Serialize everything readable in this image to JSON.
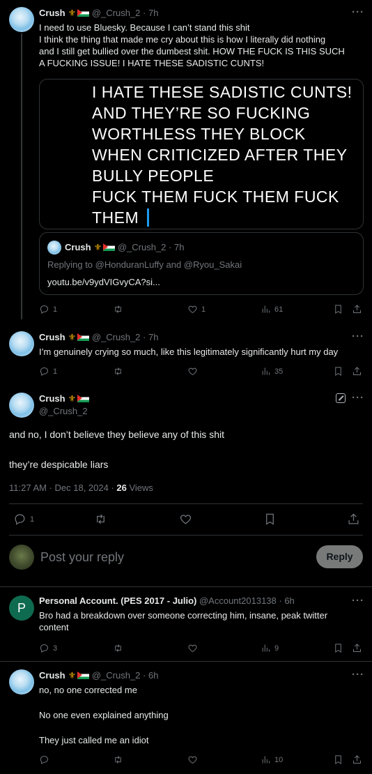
{
  "tweet1": {
    "name": "Crush",
    "handle": "@_Crush_2",
    "time": "7h",
    "text_lines": [
      "I need to use Bluesky. Because I can’t stand this shit",
      "I think the thing that made me cry about this is how I literally did nothing",
      "and I still get bullied over the dumbest shit. HOW THE FUCK IS THIS SUCH",
      "A FUCKING ISSUE!  I HATE THESE SADISTIC CUNTS!"
    ],
    "image_text_lines": [
      "I HATE THESE SADISTIC CUNTS!",
      "AND THEY’RE SO FUCKING",
      "WORTHLESS THEY BLOCK",
      "WHEN CRITICIZED AFTER THEY",
      "BULLY PEOPLE",
      "FUCK THEM FUCK THEM FUCK",
      "THEM"
    ],
    "quote": {
      "name": "Crush",
      "handle": "@_Crush_2",
      "time": "7h",
      "replying": "Replying to @HonduranLuffy and @Ryou_Sakai",
      "link": "youtu.be/v9ydVIGvyCA?si..."
    },
    "replies": "1",
    "reposts": "",
    "likes": "1",
    "views": "61"
  },
  "tweet2": {
    "name": "Crush",
    "handle": "@_Crush_2",
    "time": "7h",
    "text": "I’m genuinely crying so much, like this legitimately significantly hurt my day",
    "replies": "1",
    "reposts": "",
    "likes": "",
    "views": "35"
  },
  "main": {
    "name": "Crush",
    "handle": "@_Crush_2",
    "text1": "and no, I don’t believe they believe any of this shit",
    "text2": "they’re despicable liars",
    "timestamp": "11:27 AM · Dec 18, 2024 · ",
    "views_count": "26",
    "views_label": " Views",
    "replies": "1"
  },
  "compose": {
    "placeholder": "Post your reply",
    "button": "Reply"
  },
  "reply1": {
    "avatar_letter": "P",
    "name": "Personal Account. (PES 2017 - Julio)",
    "handle": "@Account2013138",
    "time": "6h",
    "text_lines": [
      "Bro had a breakdown over someone correcting him, insane, peak twitter",
      "content"
    ],
    "replies": "3",
    "views": "9"
  },
  "reply2": {
    "name": "Crush",
    "handle": "@_Crush_2",
    "time": "6h",
    "text_lines": [
      "no, no one corrected me",
      "No one even explained anything",
      "They just called me an idiot"
    ],
    "views": "10"
  },
  "colors": {
    "accent": "#1d9bf0",
    "reply_button_bg": "#eff3f4",
    "muted": "#71767b",
    "divider": "#2f3336"
  },
  "icons": [
    "reply-icon",
    "repost-icon",
    "like-icon",
    "views-icon",
    "bookmark-icon",
    "share-icon",
    "more-icon",
    "grok-icon",
    "crown-icon",
    "palestine-flag-icon"
  ]
}
